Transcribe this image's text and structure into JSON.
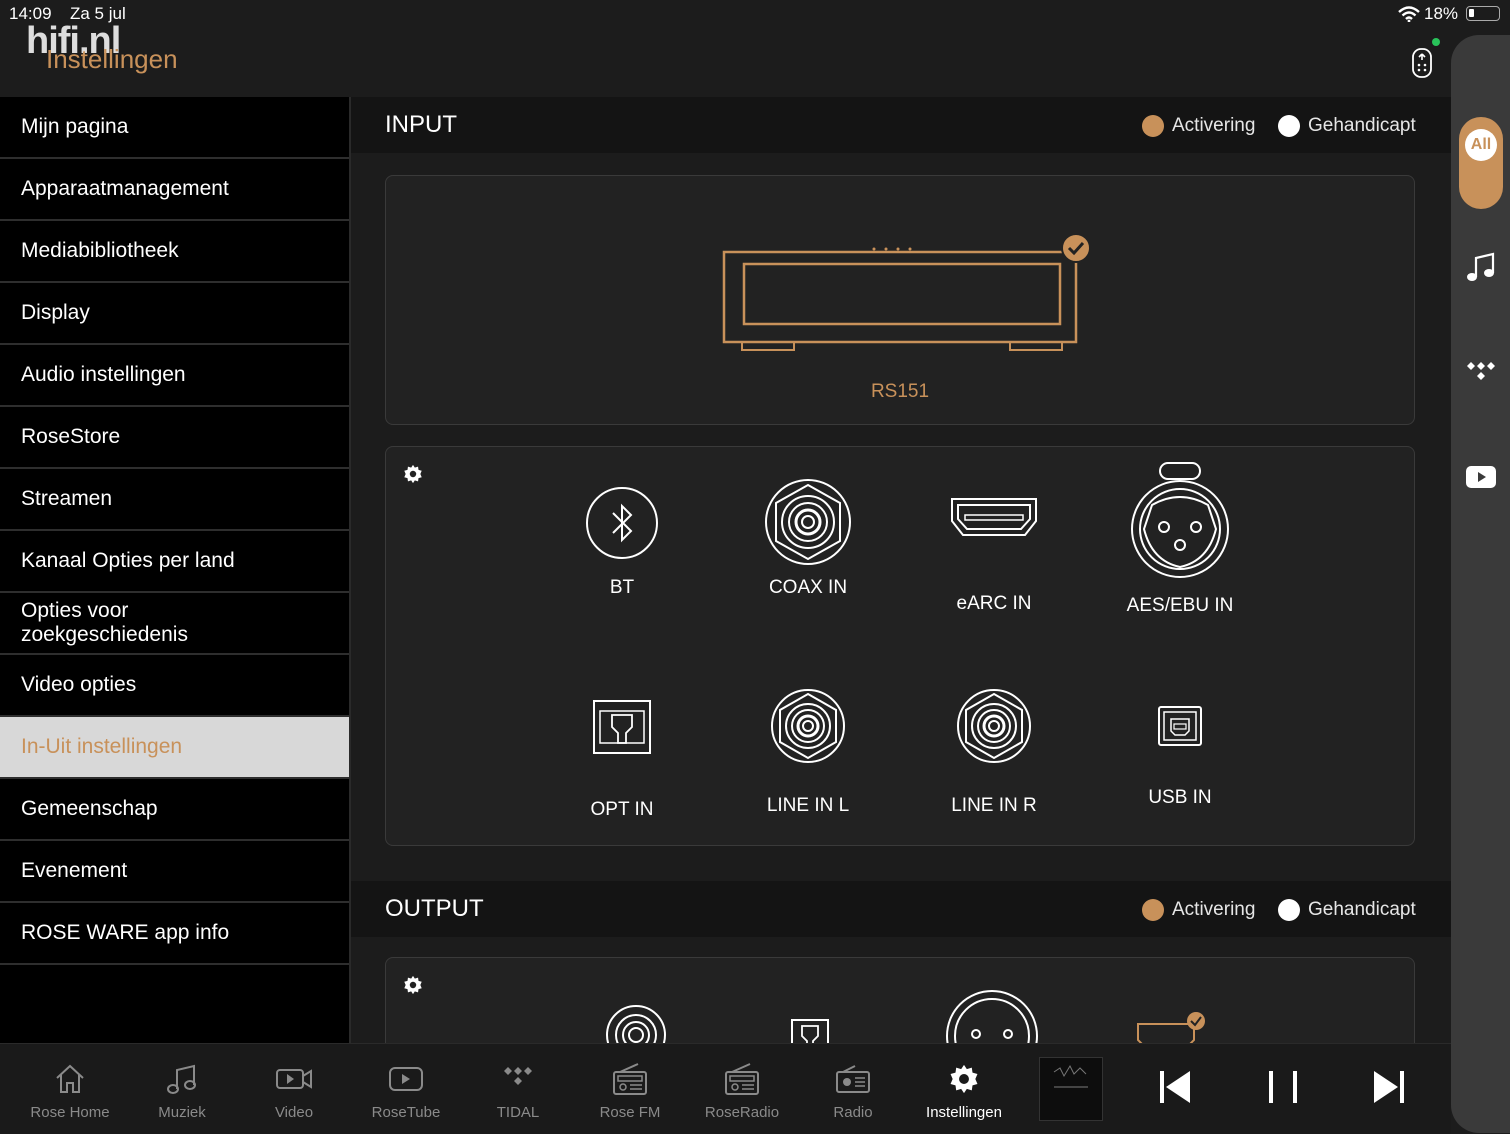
{
  "status": {
    "time": "14:09",
    "date": "Za 5 jul",
    "battery": "18%",
    "wifi_icon": "wifi-icon"
  },
  "watermark": "hifi.nl",
  "page_title": "Instellingen",
  "colors": {
    "accent": "#c8915a",
    "active_status_dot": "#29c35a"
  },
  "sidebar": {
    "items": [
      {
        "label": "Mijn pagina"
      },
      {
        "label": "Apparaatmanagement"
      },
      {
        "label": "Mediabibliotheek"
      },
      {
        "label": "Display"
      },
      {
        "label": "Audio instellingen"
      },
      {
        "label": "RoseStore"
      },
      {
        "label": "Streamen"
      },
      {
        "label": "Kanaal Opties per land"
      },
      {
        "label": "Opties voor\nzoekgeschiedenis"
      },
      {
        "label": "Video opties"
      },
      {
        "label": "In-Uit instellingen"
      },
      {
        "label": "Gemeenschap"
      },
      {
        "label": "Evenement"
      },
      {
        "label": "ROSE WARE app info"
      }
    ],
    "active_index": 10
  },
  "input": {
    "title": "INPUT",
    "legend_active": "Activering",
    "legend_disabled": "Gehandicapt",
    "device_name": "RS151",
    "ports": [
      {
        "label": "BT",
        "icon": "bluetooth-icon"
      },
      {
        "label": "COAX IN",
        "icon": "coax-icon"
      },
      {
        "label": "eARC IN",
        "icon": "hdmi-icon"
      },
      {
        "label": "AES/EBU IN",
        "icon": "xlr-icon"
      },
      {
        "label": "OPT IN",
        "icon": "optical-icon"
      },
      {
        "label": "LINE IN L",
        "icon": "rca-icon"
      },
      {
        "label": "LINE IN R",
        "icon": "rca-icon"
      },
      {
        "label": "USB IN",
        "icon": "usb-b-icon"
      }
    ]
  },
  "output": {
    "title": "OUTPUT",
    "legend_active": "Activering",
    "legend_disabled": "Gehandicapt"
  },
  "right_rail": {
    "all_label": "All"
  },
  "bottom_nav": [
    {
      "label": "Rose Home",
      "icon": "home-icon"
    },
    {
      "label": "Muziek",
      "icon": "music-note-icon"
    },
    {
      "label": "Video",
      "icon": "video-icon"
    },
    {
      "label": "RoseTube",
      "icon": "play-box-icon"
    },
    {
      "label": "TIDAL",
      "icon": "tidal-icon"
    },
    {
      "label": "Rose FM",
      "icon": "radio-icon"
    },
    {
      "label": "RoseRadio",
      "icon": "radio-icon"
    },
    {
      "label": "Radio",
      "icon": "radio-icon"
    },
    {
      "label": "Instellingen",
      "icon": "gear-icon"
    }
  ]
}
